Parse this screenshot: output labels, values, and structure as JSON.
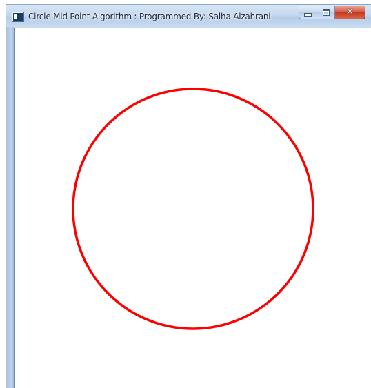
{
  "window": {
    "title": "Circle Mid Point Algorithm : Programmed By: Salha Alzahrani",
    "icon": "application-icon"
  },
  "caption_buttons": {
    "minimize_icon": "minimize-icon",
    "maximize_icon": "maximize-icon",
    "close_icon": "close-icon",
    "close_color": "#c4391f"
  },
  "canvas": {
    "background": "#ffffff",
    "shape": "circle",
    "stroke_color": "#ff0000"
  }
}
